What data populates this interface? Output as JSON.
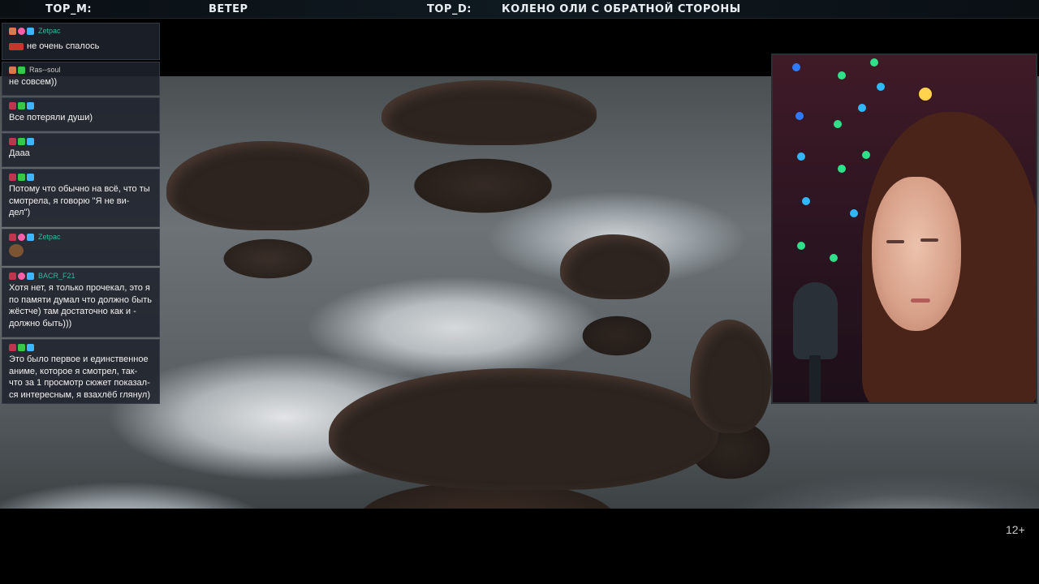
{
  "topbar": {
    "top_m_label": "TOP_M:",
    "top_m_value": "ВЕТЕР",
    "top_d_label": "TOP_D:",
    "top_d_value": "КОЛЕНО ОЛИ С ОБРАТНОЙ СТОРОНЫ"
  },
  "chat": {
    "messages": [
      {
        "user": "Zetpac",
        "user_color": "#3fb3a0",
        "text": "не очень спалось"
      },
      {
        "user": "Ras--soul",
        "user_color": "#c9c9c9",
        "text": "не совсем))"
      },
      {
        "user": "",
        "user_color": "#3045c8",
        "text": "Все потеряли души)"
      },
      {
        "user": "",
        "user_color": "#3045c8",
        "text": "Дааа"
      },
      {
        "user": "",
        "user_color": "#3045c8",
        "text": "Потому что обычно на всё, что ты смотрела, я говорю \"Я не ви- дел\")"
      },
      {
        "user": "Zetpac",
        "user_color": "#3fb3a0",
        "text": ""
      },
      {
        "user": "BACR_F21",
        "user_color": "#3fb3a0",
        "text": "Хотя нет, я только прочекал, это я по памяти думал что должно быть жёстче) там достаточно как и - должно быть)))"
      },
      {
        "user": "",
        "user_color": "#3045c8",
        "text": "Это было первое и единственное аниме, которое я смотрел, так- что за 1 просмотр сюжет показал- ся интересным, я взахлёб глянул)"
      }
    ]
  },
  "video": {
    "content": "river-rapids-rocks"
  },
  "rating": "12+"
}
